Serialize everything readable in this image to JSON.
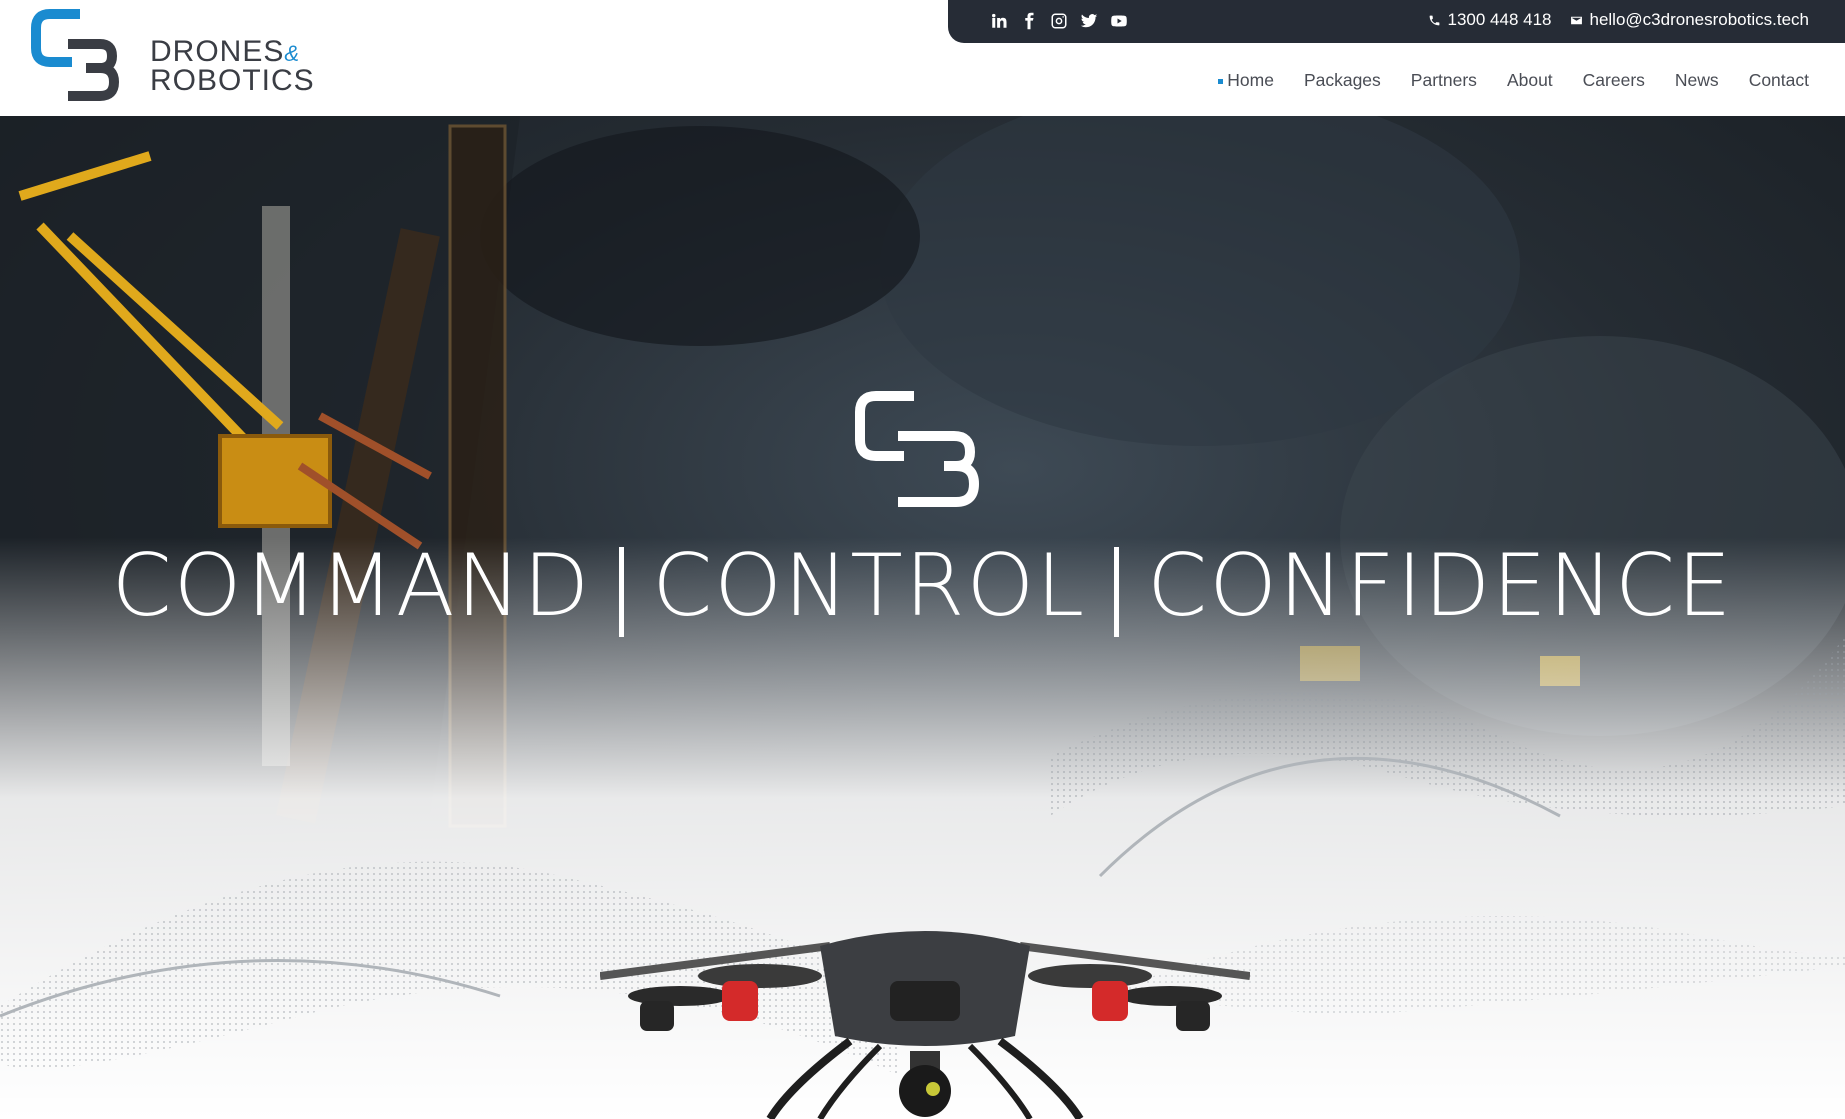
{
  "brand": {
    "line1": "DRONES",
    "amp": "&",
    "line2": "ROBOTICS",
    "logo_icon": "c3-logo-icon"
  },
  "topbar": {
    "social": [
      "linkedin-icon",
      "facebook-icon",
      "instagram-icon",
      "twitter-icon",
      "youtube-icon"
    ],
    "phone": "1300 448 418",
    "email": "hello@c3dronesrobotics.tech"
  },
  "nav": {
    "items": [
      "Home",
      "Packages",
      "Partners",
      "About",
      "Careers",
      "News",
      "Contact"
    ],
    "active": "Home"
  },
  "hero": {
    "words": [
      "COMMAND",
      "CONTROL",
      "CONFIDENCE"
    ]
  },
  "colors": {
    "accent": "#1a8bd0",
    "topbar": "#262c36",
    "text": "#4a4d55"
  }
}
